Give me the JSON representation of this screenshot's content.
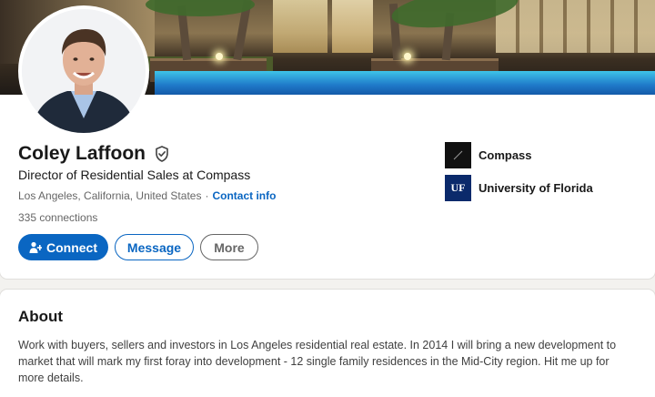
{
  "profile": {
    "name": "Coley Laffoon",
    "verified_icon": "verified-shield-icon",
    "headline": "Director of Residential Sales at Compass",
    "location": "Los Angeles, California, United States",
    "separator": "·",
    "contact_info_label": "Contact info",
    "connections": "335 connections",
    "actions": {
      "connect_label": "Connect",
      "connect_icon": "add-person-icon",
      "message_label": "Message",
      "more_label": "More"
    },
    "organizations": [
      {
        "name": "Compass",
        "logo": "compass-logo"
      },
      {
        "name": "University of Florida",
        "logo": "uf-logo",
        "logo_text": "UF"
      }
    ]
  },
  "about": {
    "title": "About",
    "text": "Work with buyers, sellers and investors in Los Angeles residential real estate. In 2014 I will bring a new development to market that will mark my first foray into development - 12 single family residences in the Mid-City region. Hit me up for more details."
  },
  "colors": {
    "primary_blue": "#0a66c2",
    "background": "#f3f2ef",
    "text_primary": "#191919",
    "text_secondary": "#666666"
  }
}
